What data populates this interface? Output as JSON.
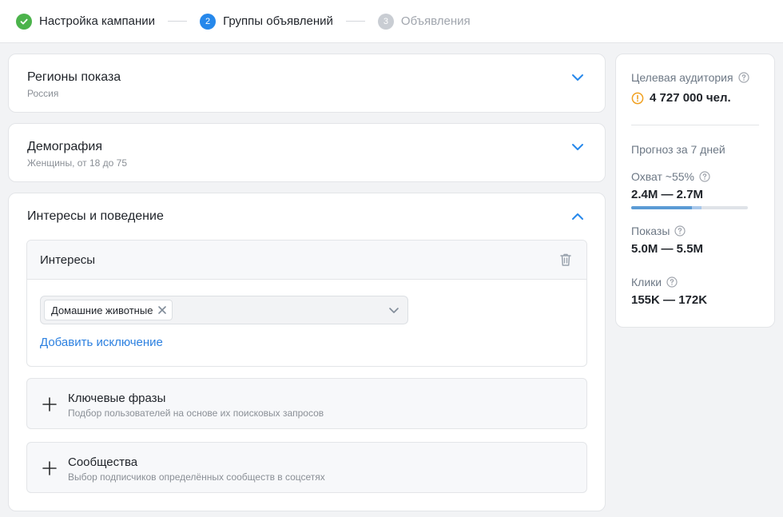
{
  "stepper": {
    "steps": [
      {
        "num": "",
        "label": "Настройка кампании",
        "state": "done"
      },
      {
        "num": "2",
        "label": "Группы объявлений",
        "state": "active"
      },
      {
        "num": "3",
        "label": "Объявления",
        "state": "pending"
      }
    ]
  },
  "regions": {
    "title": "Регионы показа",
    "summary": "Россия"
  },
  "demography": {
    "title": "Демография",
    "summary": "Женщины, от 18 до 75"
  },
  "interests": {
    "title": "Интересы и поведение",
    "block_title": "Интересы",
    "chips": [
      "Домашние животные"
    ],
    "add_exclusion": "Добавить исключение",
    "keywords": {
      "title": "Ключевые фразы",
      "subtitle": "Подбор пользователей на основе их поисковых запросов"
    },
    "communities": {
      "title": "Сообщества",
      "subtitle": "Выбор подписчиков определённых сообществ в соцсетях"
    }
  },
  "audience": {
    "label": "Целевая аудитория",
    "value": "4 727 000 чел.",
    "forecast_label": "Прогноз за 7 дней",
    "reach": {
      "label": "Охват ~55%",
      "value": "2.4M — 2.7M",
      "fill_fraction": 0.52,
      "range_fraction": 0.08
    },
    "impressions": {
      "label": "Показы",
      "value": "5.0M — 5.5M"
    },
    "clicks": {
      "label": "Клики",
      "value": "155K — 172K"
    }
  },
  "colors": {
    "accent": "#2688eb",
    "success": "#4bb34b",
    "warning": "#f0a020",
    "link": "#2d81e0"
  }
}
